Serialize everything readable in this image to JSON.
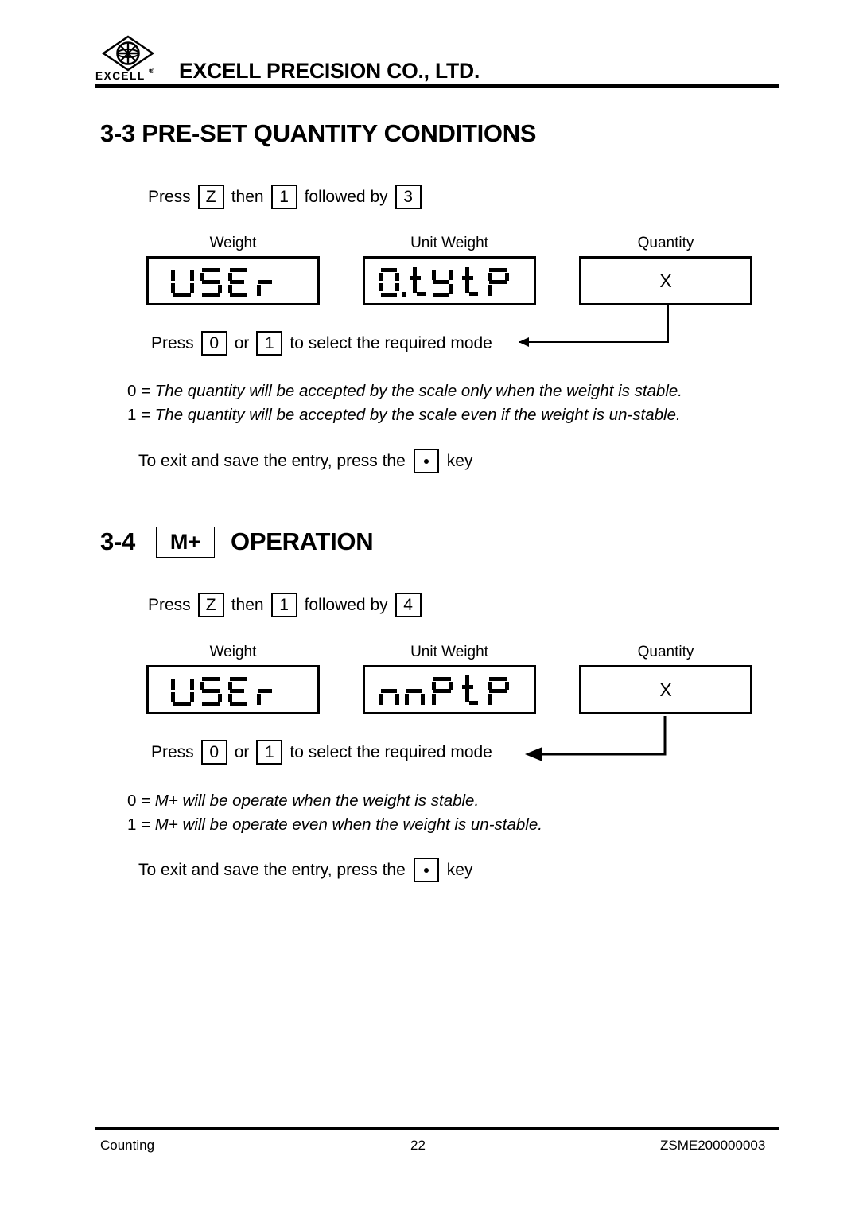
{
  "header": {
    "logo_word": "EXCELL",
    "logo_registered": "®",
    "company_name": "EXCELL PRECISION CO., LTD."
  },
  "section_33": {
    "heading": "3-3 PRE-SET QUANTITY CONDITIONS",
    "press_line": {
      "press_label": "Press",
      "key_1": "Z",
      "then_label": "then",
      "key_2": "1",
      "followed_label": "followed by",
      "key_3": "3"
    },
    "displays": [
      {
        "label": "Weight",
        "value": "USEr",
        "mode": "segment"
      },
      {
        "label": "Unit Weight",
        "value": "0.tYtP",
        "mode": "segment"
      },
      {
        "label": "Quantity",
        "value": "X",
        "mode": "text"
      }
    ],
    "select_line": {
      "press_label": "Press",
      "key_0": "0",
      "or_label": "or",
      "key_1": "1",
      "tail_label": "to select the required mode"
    },
    "options": [
      {
        "key": "0 =",
        "text": "The quantity will be accepted by the scale only when the weight is stable."
      },
      {
        "key": "1 =",
        "text": "The quantity will be accepted by the scale even if the weight is un-stable."
      }
    ],
    "exit_line": {
      "lead": "To exit and save the entry, press the",
      "key": "•",
      "tail": "key"
    }
  },
  "section_34": {
    "number": "3-4",
    "key_label": "M+",
    "heading": "OPERATION",
    "press_line": {
      "press_label": "Press",
      "key_1": "Z",
      "then_label": "then",
      "key_2": "1",
      "followed_label": "followed by",
      "key_3": "4"
    },
    "displays": [
      {
        "label": "Weight",
        "value": "USEr",
        "mode": "segment"
      },
      {
        "label": "Unit Weight",
        "value": "nnPtP",
        "mode": "segment"
      },
      {
        "label": "Quantity",
        "value": "X",
        "mode": "text"
      }
    ],
    "select_line": {
      "press_label": "Press",
      "key_0": "0",
      "or_label": "or",
      "key_1": "1",
      "tail_label": "to select the required mode"
    },
    "options": [
      {
        "key": "0 =",
        "text": "M+ will be operate when the weight is stable."
      },
      {
        "key": "1 =",
        "text": "M+ will be operate even when the weight is un-stable."
      }
    ],
    "exit_line": {
      "lead": "To exit and save the entry, press the",
      "key": "•",
      "tail": "key"
    }
  },
  "footer": {
    "left": "Counting",
    "center": "22",
    "right": "ZSME200000003"
  },
  "colors": {
    "ink": "#000000",
    "paper": "#ffffff"
  }
}
